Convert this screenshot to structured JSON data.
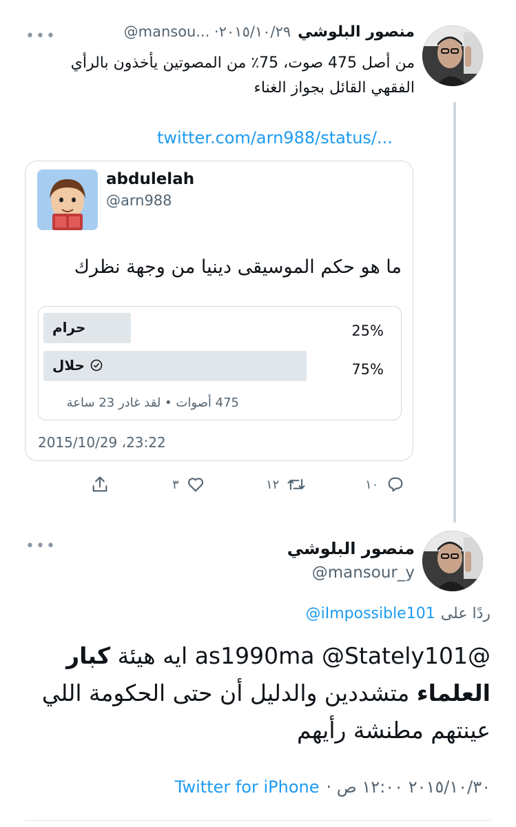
{
  "tweet1": {
    "display_name": "منصور البلوشي",
    "handle_date": "@mansou... ·٢٠١٥/١٠/٢٩",
    "more": "•••",
    "text_line1": "من أصل 475 صوت، 75٪ من المصوتين يأخذون بالرأي",
    "text_line2": "الفقهي القائل بجواز الغناء",
    "link": "twitter.com/arn988/status/...",
    "quoted": {
      "name": "abdulelah",
      "handle": "@arn988",
      "question": "ما هو حكم الموسيقى دينيا من وجهة نظرك",
      "poll": {
        "options": [
          {
            "label": "حرام",
            "percent_text": "25%",
            "percent": 25,
            "winner": false
          },
          {
            "label": "حلال",
            "percent_text": "75%",
            "percent": 75,
            "winner": true
          }
        ],
        "footer": "475 أصوات • لقد غادر 23 ساعة"
      },
      "timestamp": "2015/10/29 ،23:22"
    },
    "actions": {
      "reply_count": "١٠",
      "retweet_count": "١٢",
      "like_count": "٣"
    }
  },
  "tweet2": {
    "display_name": "منصور البلوشي",
    "handle": "@mansour_y",
    "more": "•••",
    "reply_prefix": "ردًا على",
    "reply_to": "@iImpossible101",
    "text_line1_start": "@as1990ma @Stately101 ايه هيئة ",
    "text_bold1": "كبار",
    "text_bold2": "العلماء",
    "text_line2_rest": " متشددين والدليل أن حتى الحكومة اللي",
    "text_line3": "عينتهم مطنشة رأيهم",
    "meta_date": "٢٠١٥/١٠/٣٠ ١٢:٠٠ ص ·",
    "source": "Twitter for iPhone"
  },
  "colors": {
    "link": "#1d9bf0",
    "muted": "#536471",
    "border": "#cfd9de"
  }
}
